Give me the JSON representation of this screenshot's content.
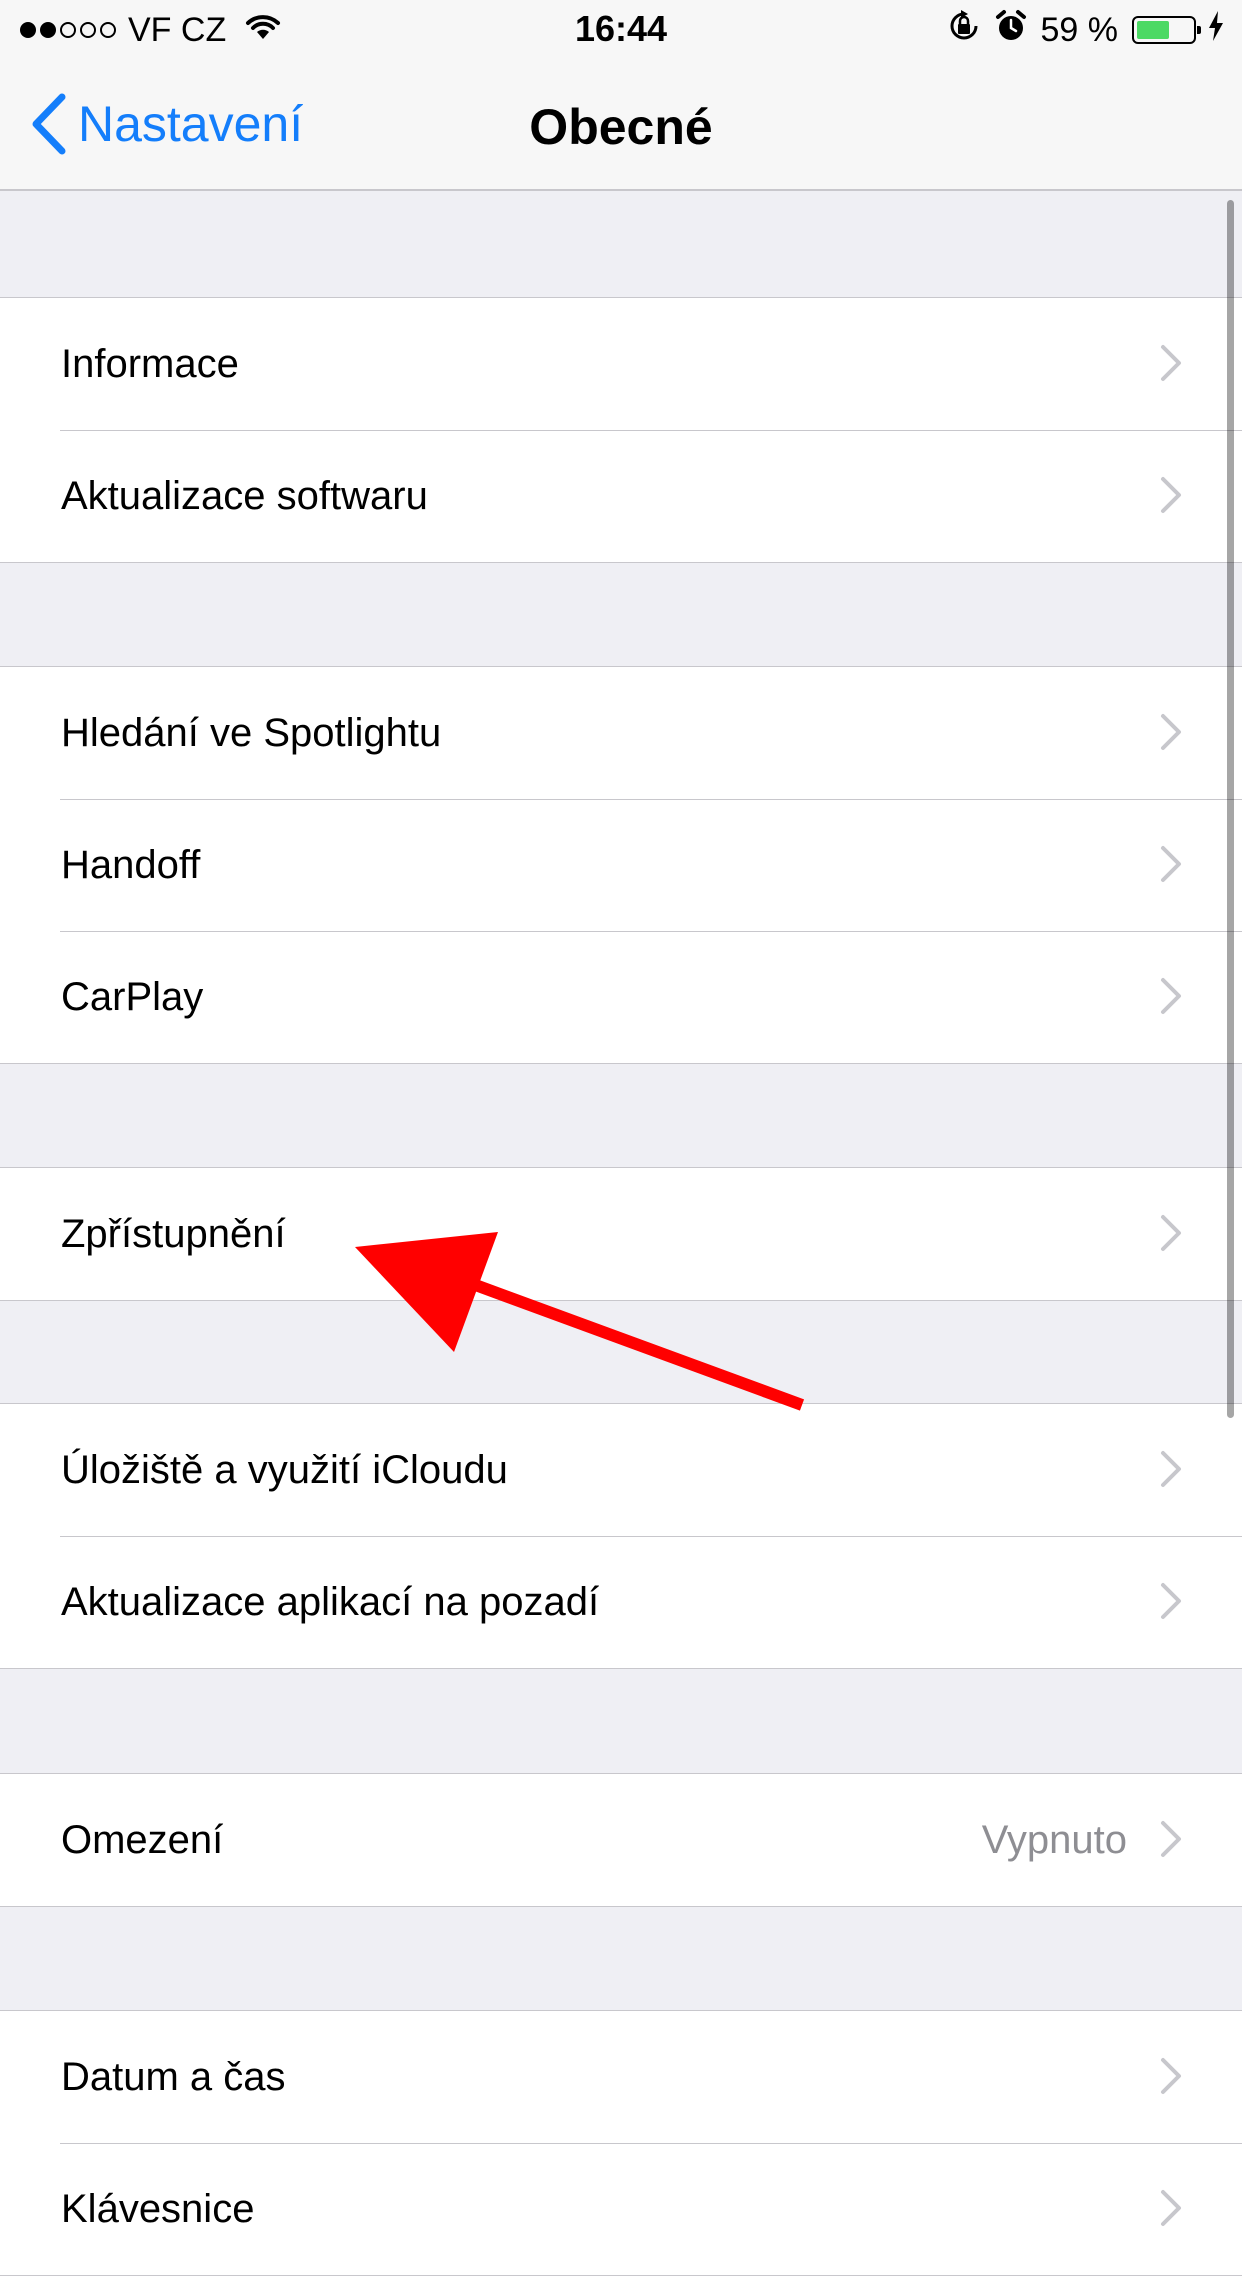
{
  "status_bar": {
    "carrier": "VF CZ",
    "time": "16:44",
    "battery_percent": "59 %",
    "battery_level": 0.59,
    "signal_strength": 2,
    "signal_max": 5,
    "icons": [
      "wifi-icon",
      "orientation-lock-icon",
      "alarm-icon",
      "battery-icon",
      "charging-bolt-icon"
    ]
  },
  "nav": {
    "back_label": "Nastavení",
    "title": "Obecné"
  },
  "groups": [
    {
      "items": [
        {
          "label": "Informace"
        },
        {
          "label": "Aktualizace softwaru"
        }
      ]
    },
    {
      "items": [
        {
          "label": "Hledání ve Spotlightu"
        },
        {
          "label": "Handoff"
        },
        {
          "label": "CarPlay"
        }
      ]
    },
    {
      "items": [
        {
          "label": "Zpřístupnění"
        }
      ]
    },
    {
      "items": [
        {
          "label": "Úložiště a využití iCloudu"
        },
        {
          "label": "Aktualizace aplikací na pozadí"
        }
      ]
    },
    {
      "items": [
        {
          "label": "Omezení",
          "detail": "Vypnuto"
        }
      ]
    },
    {
      "items": [
        {
          "label": "Datum a čas"
        },
        {
          "label": "Klávesnice"
        }
      ]
    }
  ],
  "colors": {
    "tint": "#147efb",
    "background": "#efeff4",
    "separator": "#c8c7cc",
    "chevron": "#c7c7cc",
    "detail_text": "#8e8e93",
    "annotation": "#ff0000",
    "battery_fill": "#4cd964"
  }
}
